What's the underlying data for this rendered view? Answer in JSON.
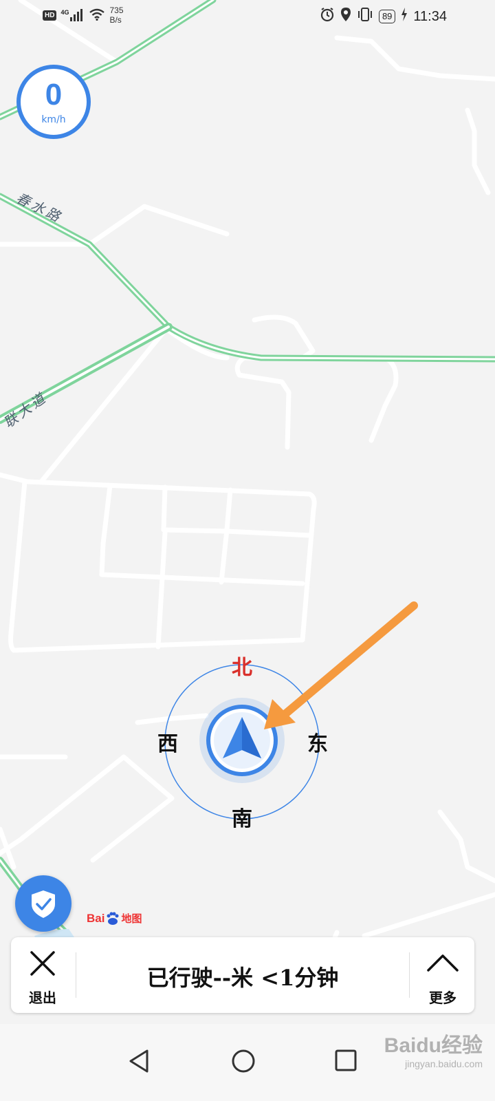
{
  "status_bar": {
    "network_badge": "HD",
    "network_type": "4G",
    "net_speed_value": "735",
    "net_speed_unit": "B/s",
    "battery": "89",
    "time": "11:34"
  },
  "speed": {
    "value": "0",
    "unit": "km/h"
  },
  "map": {
    "road_labels": [
      "春水路",
      "联大道"
    ],
    "logo_text_1": "Bai",
    "logo_text_2": "地图"
  },
  "compass": {
    "north": "北",
    "south": "南",
    "east": "东",
    "west": "西"
  },
  "bottom_panel": {
    "exit_label": "退出",
    "trip_info": "已行驶--米 <1分钟",
    "more_label": "更多"
  },
  "watermark": {
    "main": "Baidu经验",
    "sub": "jingyan.baidu.com"
  },
  "colors": {
    "accent": "#3d85e6",
    "road_green": "#7fd49c",
    "arrow_orange": "#f59a3f",
    "north_red": "#d9302b"
  }
}
